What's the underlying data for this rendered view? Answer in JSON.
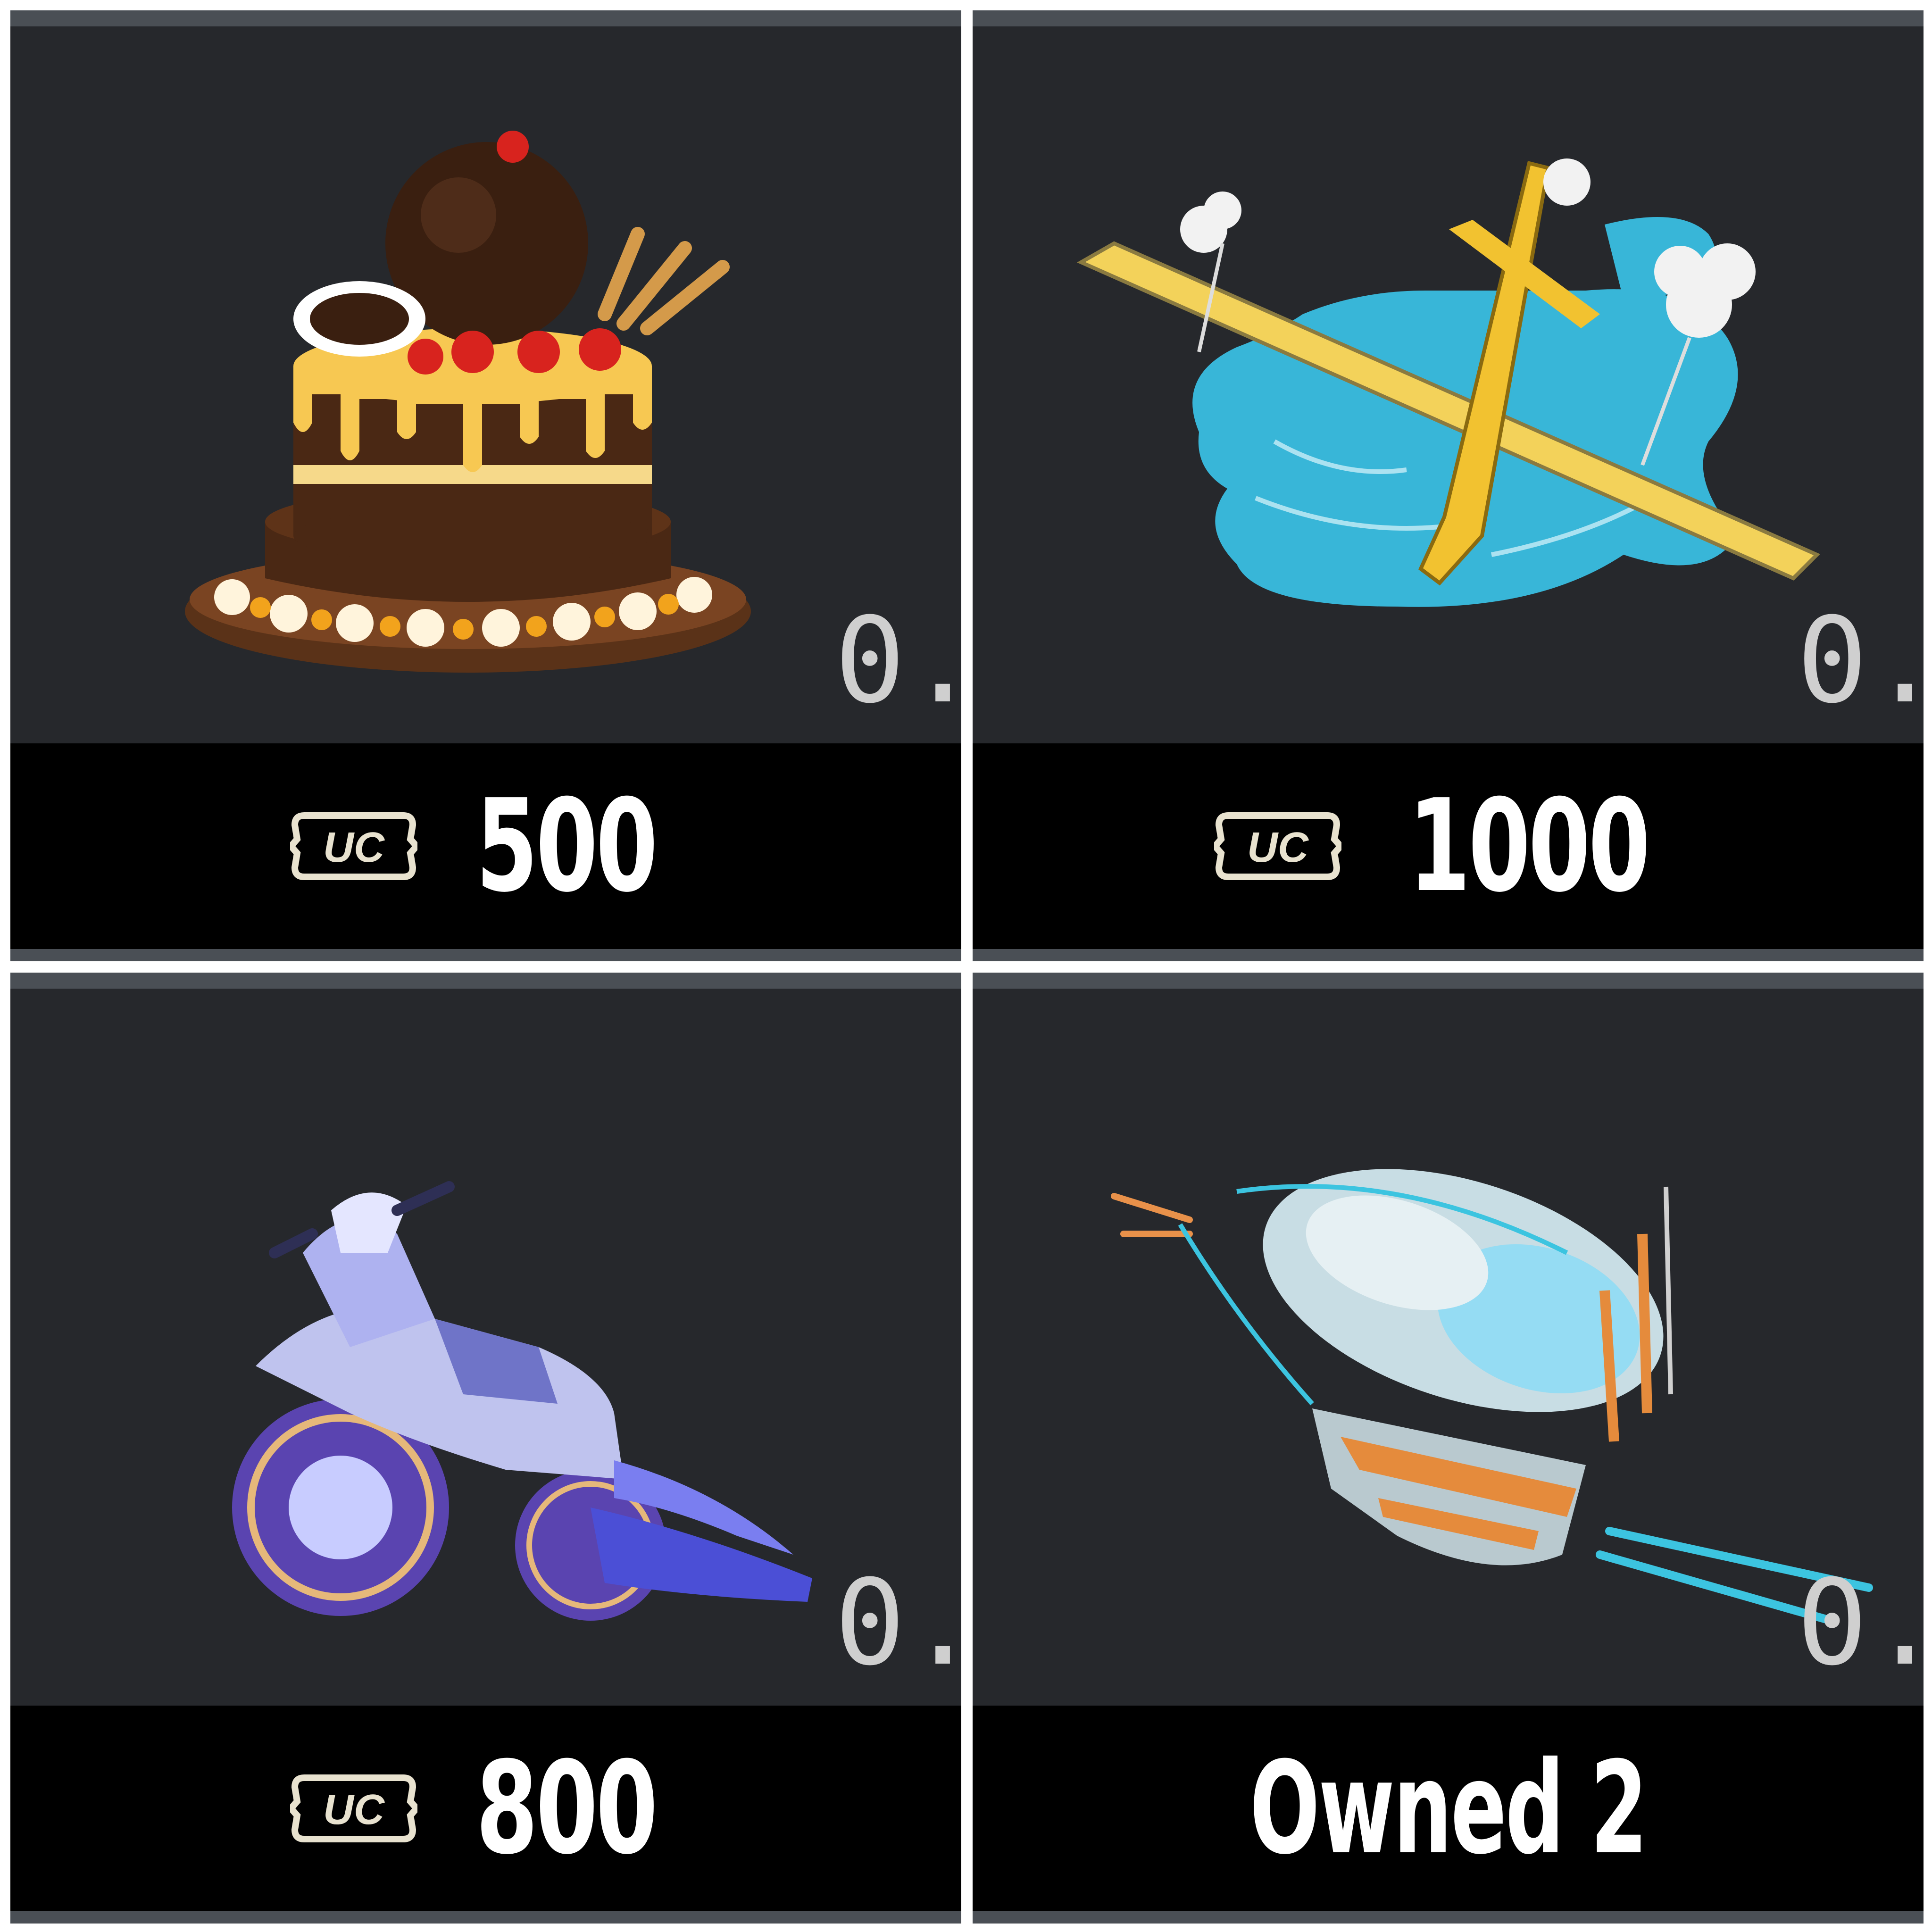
{
  "items": [
    {
      "name": "cake",
      "icon": "birthday-cake-icon",
      "currency_icon": "uc-currency-icon",
      "side_label": "0.",
      "price": "500"
    },
    {
      "name": "plane",
      "icon": "airplane-icon",
      "currency_icon": "uc-currency-icon",
      "side_label": "0.",
      "price": "1000"
    },
    {
      "name": "motorcycle",
      "icon": "motorcycle-icon",
      "currency_icon": "uc-currency-icon",
      "side_label": "0.",
      "price": "800"
    },
    {
      "name": "airship",
      "icon": "airship-icon",
      "side_label": "0.",
      "status": "Owned 2"
    }
  ],
  "colors": {
    "card_background": "#26282c",
    "price_bar": "#000000",
    "card_border": "#4a4f55",
    "price_text": "#ffffff"
  }
}
